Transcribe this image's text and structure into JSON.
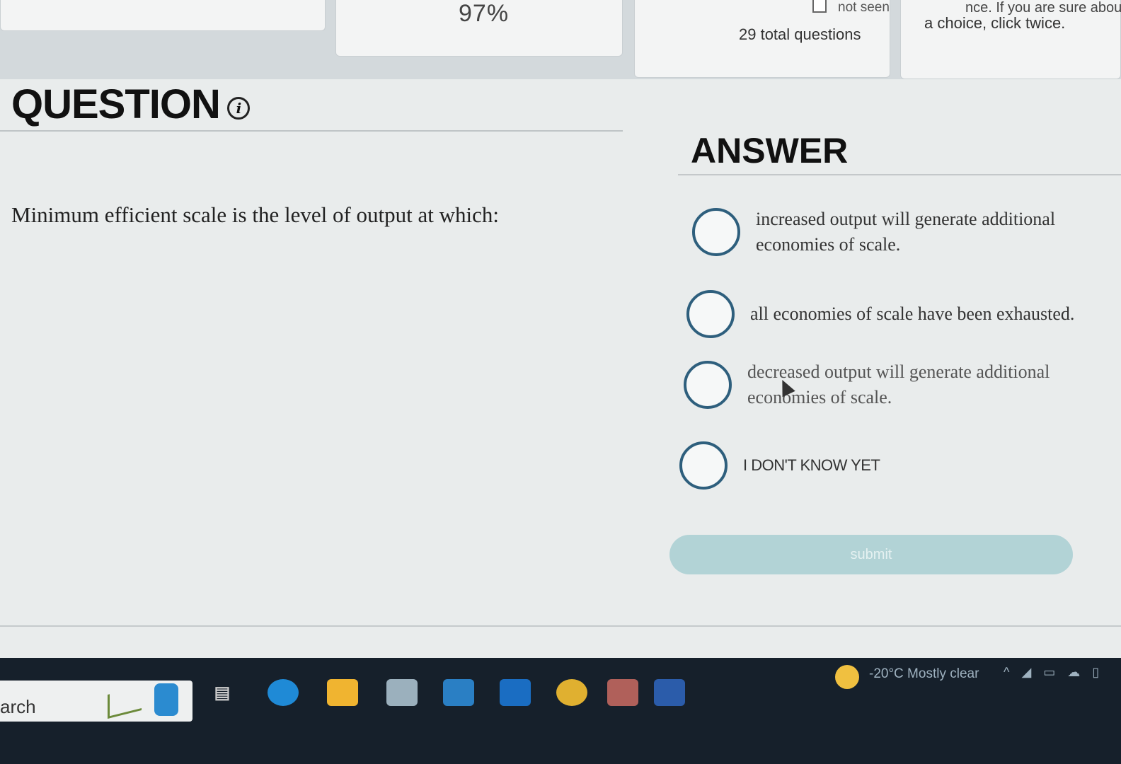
{
  "header": {
    "percent": "97%",
    "not_seen_label": "not seen",
    "total_questions": "29 total questions",
    "instruction_line1": "nce. If you are sure about",
    "instruction_line2": "a choice, click twice."
  },
  "question": {
    "heading": "QUESTION",
    "info_glyph": "i",
    "text": "Minimum efficient scale is the level of output at which:"
  },
  "answer": {
    "heading": "ANSWER",
    "options": [
      {
        "label": "increased output will generate additional economies of scale."
      },
      {
        "label": "all economies of scale have been exhausted."
      },
      {
        "label": "decreased output will generate additional economies of scale."
      },
      {
        "label": "I DON'T KNOW YET"
      }
    ],
    "submit_label": "submit"
  },
  "taskbar": {
    "search_text": "arch",
    "weather": "-20°C  Mostly clear",
    "icons": [
      "search-icon",
      "task-view-icon",
      "edge-icon",
      "file-explorer-icon",
      "store-icon",
      "mail-icon",
      "outlook-icon",
      "chrome-icon",
      "teams-icon",
      "word-icon",
      "weather-icon"
    ]
  },
  "colors": {
    "radio_border": "#2e5f7d",
    "submit_bg": "#b2d3d6",
    "taskbar_bg": "#16202b"
  }
}
